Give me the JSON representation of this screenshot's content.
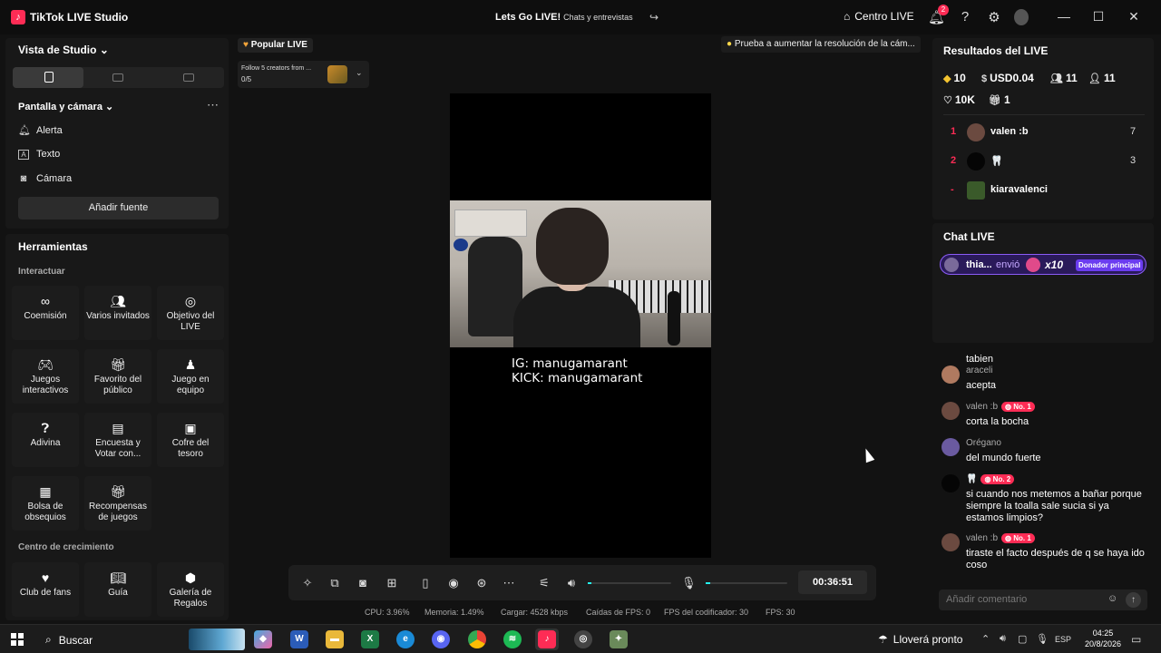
{
  "titlebar": {
    "app_name": "TikTok LIVE Studio",
    "live_title": "Lets Go LIVE!",
    "live_category": "Chats y entrevistas",
    "live_center": "Centro LIVE",
    "notif_count": "2"
  },
  "left": {
    "studio_view": "Vista de Studio",
    "sources_title": "Pantalla y cámara",
    "sources": [
      {
        "label": "Alerta"
      },
      {
        "label": "Texto"
      },
      {
        "label": "Cámara"
      }
    ],
    "add_source": "Añadir fuente",
    "tools_title": "Herramientas",
    "group_interact": "Interactuar",
    "group_growth": "Centro de crecimiento",
    "tools": [
      {
        "label": "Coemisión",
        "icon": "link-icon"
      },
      {
        "label": "Varios invitados",
        "icon": "people-icon"
      },
      {
        "label": "Objetivo del LIVE",
        "icon": "target-icon"
      },
      {
        "label": "Juegos interactivos",
        "icon": "gamepad-icon"
      },
      {
        "label": "Favorito del público",
        "icon": "gift-icon"
      },
      {
        "label": "Juego en equipo",
        "icon": "team-icon"
      },
      {
        "label": "Adivina",
        "icon": "question-icon"
      },
      {
        "label": "Encuesta y Votar con...",
        "icon": "poll-icon"
      },
      {
        "label": "Cofre del tesoro",
        "icon": "chest-icon"
      },
      {
        "label": "Bolsa de obsequios",
        "icon": "bag-icon"
      },
      {
        "label": "Recompensas de juegos",
        "icon": "reward-icon"
      },
      {
        "label": "Club de fans",
        "icon": "heart-icon"
      },
      {
        "label": "Guía",
        "icon": "book-icon"
      },
      {
        "label": "Galería de Regalos",
        "icon": "gallery-icon"
      }
    ]
  },
  "stage": {
    "popular_live": "Popular LIVE",
    "follow_text": "Follow 5 creators from ...",
    "follow_progress": "0/5",
    "tip": "Prueba a aumentar la resolución de la cám...",
    "cam_line1": "IG: manugamarant",
    "cam_line2": "KICK: manugamarant",
    "timer": "00:36:51",
    "volume_level": 0.02,
    "mic_level": 0.06,
    "stats": {
      "cpu": "CPU: 3.96%",
      "mem": "Memoria: 1.49%",
      "load": "Cargar: 4528 kbps",
      "fps_drops": "Caídas de FPS: 0",
      "enc_fps": "FPS del codificador: 30",
      "fps": "FPS: 30"
    }
  },
  "results": {
    "title": "Resultados del LIVE",
    "diamonds": "10",
    "usd": "USD0.04",
    "viewers": "11",
    "followers": "11",
    "likes": "10K",
    "gifts": "1",
    "ranking": [
      {
        "pos": "1",
        "name": "valen :b",
        "score": "7"
      },
      {
        "pos": "2",
        "name": "🦷",
        "score": "3"
      },
      {
        "pos": "-",
        "name": "kiaravalenci",
        "score": ""
      }
    ]
  },
  "chat": {
    "title": "Chat LIVE",
    "gift_user": "thia...",
    "gift_verb": "envió",
    "gift_count": "x10",
    "gift_badge": "Donador principal",
    "messages": [
      {
        "user": "",
        "level": "",
        "text": "tabien"
      },
      {
        "user": "araceli",
        "level": "",
        "text": "acepta"
      },
      {
        "user": "valen :b",
        "level": "No. 1",
        "text": "corta la bocha"
      },
      {
        "user": "Orégano",
        "level": "",
        "text": "del mundo fuerte"
      },
      {
        "user": "🦷",
        "level": "No. 2",
        "text": "si cuando nos metemos a bañar porque siempre la toalla sale sucia si ya estamos limpios?"
      },
      {
        "user": "valen :b",
        "level": "No. 1",
        "text": "tiraste el facto después de q se haya ido coso"
      }
    ],
    "comment_placeholder": "Añadir comentario"
  },
  "taskbar": {
    "search": "Buscar",
    "weather": "Lloverá pronto",
    "lang": "ESP",
    "time": "04:25",
    "date": "20/8/2026"
  },
  "colors": {
    "accent": "#fe2c55",
    "cyan": "#25f4ee",
    "purple": "#8b5cf6"
  }
}
